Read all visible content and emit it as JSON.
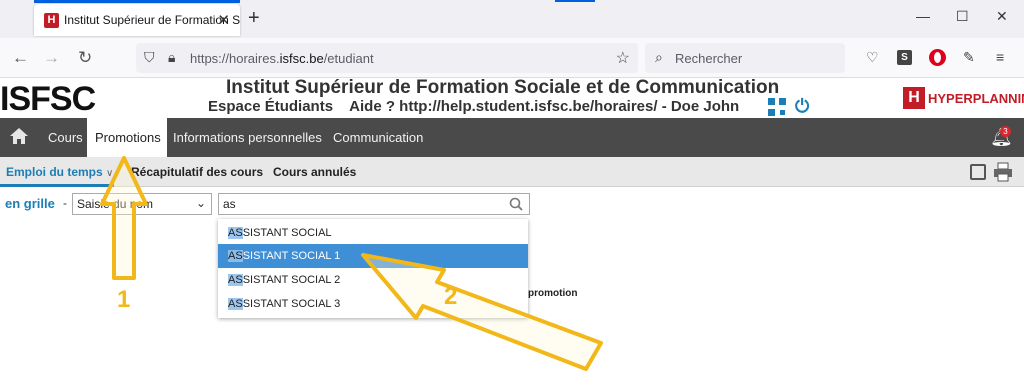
{
  "browser": {
    "tab_title": "Institut Supérieur de Formation S",
    "favicon_letter": "H",
    "tab_close": "✕",
    "new_tab": "+",
    "url_prefix": "https://horaires.",
    "url_domain": "isfsc.be",
    "url_path": "/etudiant",
    "search_placeholder": "Rechercher",
    "extension_s": "S"
  },
  "site": {
    "logo": "ISFSC",
    "title": "Institut Supérieur de Formation Sociale et de Communication",
    "subtitle": "Espace Étudiants    Aide ? http://help.student.isfsc.be/horaires/ - Doe John",
    "hp_letter": "H",
    "hp_text": "HYPERPLANNING"
  },
  "mainnav": {
    "items": [
      "Cours",
      "Promotions",
      "Informations personnelles",
      "Communication"
    ],
    "active": "Promotions",
    "notification_count": "3"
  },
  "subnav": {
    "items": [
      "Emploi du temps",
      "Récapitulatif des cours",
      "Cours annulés"
    ],
    "active": "Emploi du temps",
    "chevron": "∨"
  },
  "filter": {
    "mode_label": "en grille",
    "dash": "-",
    "select_value": "Saisie du nom",
    "search_value": "as"
  },
  "dropdown": {
    "items": [
      {
        "match": "AS",
        "rest": "SISTANT SOCIAL"
      },
      {
        "match": "AS",
        "rest": "SISTANT SOCIAL 1"
      },
      {
        "match": "AS",
        "rest": "SISTANT SOCIAL 2"
      },
      {
        "match": "AS",
        "rest": "SISTANT SOCIAL 3"
      }
    ],
    "selected_index": 1
  },
  "background_text": "promotion",
  "annotations": {
    "step1": "1",
    "step2": "2",
    "color": "#f2b718"
  },
  "colors": {
    "accent": "#1b7fb6",
    "nav_bg": "#4a4a4a",
    "brand_red": "#c21d27",
    "selection": "#3f8fd6"
  }
}
